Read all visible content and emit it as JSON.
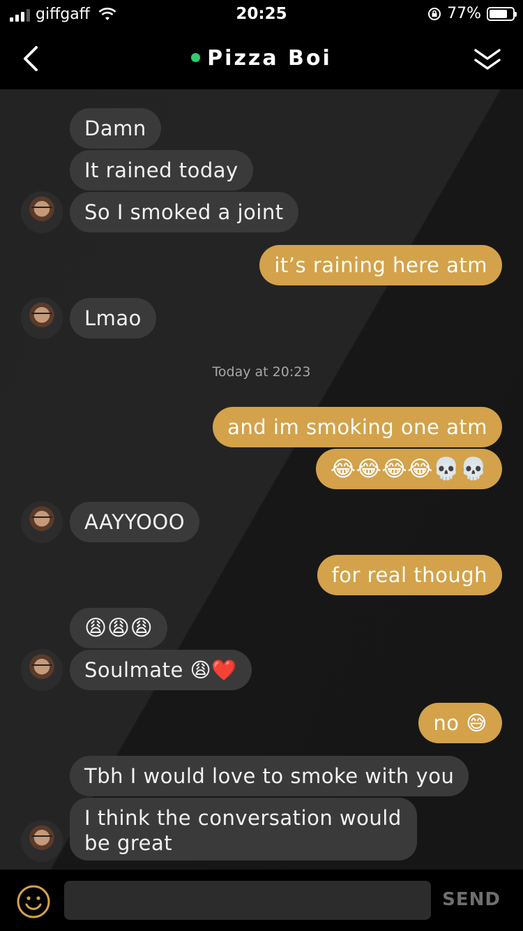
{
  "status_bar": {
    "carrier": "giffgaff",
    "time": "20:25",
    "battery": "77%"
  },
  "header": {
    "title": "Pizza Boi",
    "online_color": "#2ecc71"
  },
  "colors": {
    "incoming_bubble": "#3a3a3a",
    "outgoing_bubble": "#d3a24a",
    "background": "#161616"
  },
  "messages": [
    {
      "from": "contact",
      "text": "Damn"
    },
    {
      "from": "contact",
      "text": "It rained today"
    },
    {
      "from": "contact",
      "text": "So I smoked a joint"
    },
    {
      "from": "me",
      "text": "it’s raining here atm"
    },
    {
      "from": "contact",
      "text": "Lmao"
    },
    {
      "from": "me",
      "text": "and im smoking one atm"
    },
    {
      "from": "me",
      "text": "😂😂😂😂💀💀"
    },
    {
      "from": "contact",
      "text": "AAYYOOO"
    },
    {
      "from": "me",
      "text": "for real though"
    },
    {
      "from": "contact",
      "text": "😩😩😩"
    },
    {
      "from": "contact",
      "text": "Soulmate 😩❤️"
    },
    {
      "from": "me",
      "text": "no 😅"
    },
    {
      "from": "contact",
      "text": "Tbh I would love to smoke with you"
    },
    {
      "from": "contact",
      "text": "I think the conversation would be great"
    }
  ],
  "timestamp": "Today at 20:23",
  "composer": {
    "value": "",
    "send_label": "SEND"
  }
}
